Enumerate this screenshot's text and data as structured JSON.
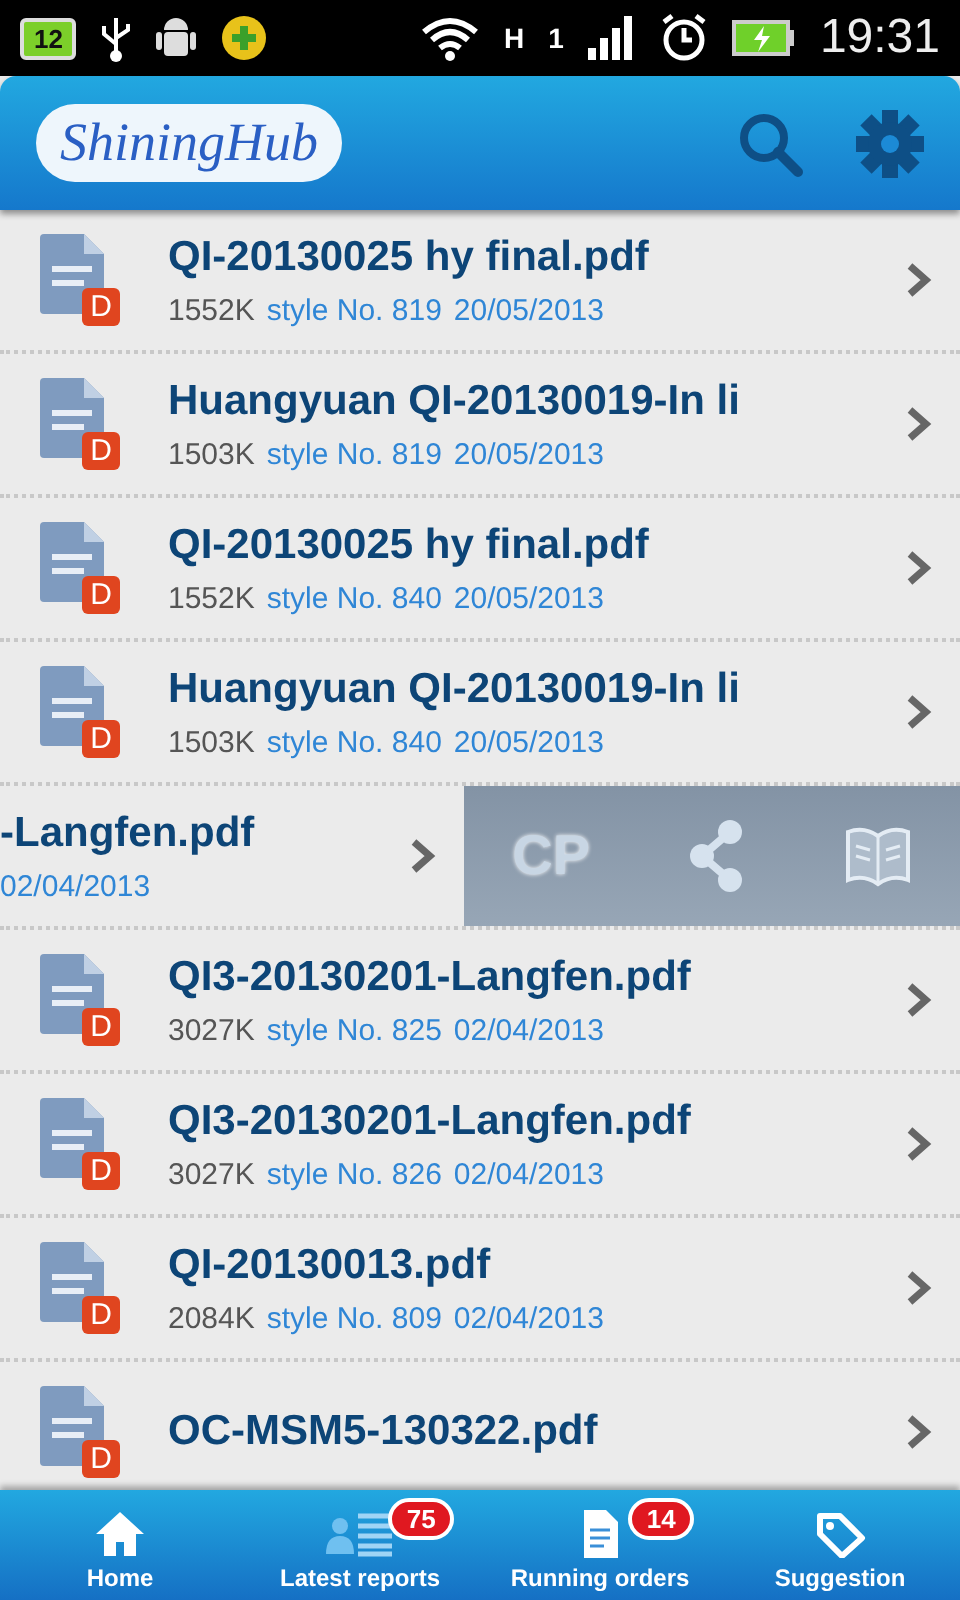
{
  "status_bar": {
    "notification_number": "12",
    "network_type": "H",
    "sim_number": "1",
    "time": "19:31"
  },
  "header": {
    "logo": "ShiningHub"
  },
  "files": [
    {
      "kind": "file",
      "name": "QI-20130025 hy final.pdf",
      "badge": "D",
      "size": "1552K",
      "style": "style No. 819",
      "date": "20/05/2013"
    },
    {
      "kind": "file",
      "name": "Huangyuan QI-20130019-In li",
      "badge": "D",
      "size": "1503K",
      "style": "style No. 819",
      "date": "20/05/2013"
    },
    {
      "kind": "file",
      "name": "QI-20130025 hy final.pdf",
      "badge": "D",
      "size": "1552K",
      "style": "style No. 840",
      "date": "20/05/2013"
    },
    {
      "kind": "file",
      "name": "Huangyuan QI-20130019-In li",
      "badge": "D",
      "size": "1503K",
      "style": "style No. 840",
      "date": "20/05/2013"
    },
    {
      "kind": "swiped",
      "name": "-Langfen.pdf",
      "date": "02/04/2013",
      "actions": [
        {
          "kind": "text",
          "label": "CP"
        },
        {
          "kind": "share"
        },
        {
          "kind": "read"
        }
      ]
    },
    {
      "kind": "file",
      "name": "QI3-20130201-Langfen.pdf",
      "badge": "D",
      "size": "3027K",
      "style": "style No. 825",
      "date": "02/04/2013"
    },
    {
      "kind": "file",
      "name": "QI3-20130201-Langfen.pdf",
      "badge": "D",
      "size": "3027K",
      "style": "style No. 826",
      "date": "02/04/2013"
    },
    {
      "kind": "file",
      "name": "QI-20130013.pdf",
      "badge": "D",
      "size": "2084K",
      "style": "style No. 809",
      "date": "02/04/2013"
    },
    {
      "kind": "file",
      "name": "OC-MSM5-130322.pdf",
      "badge": "D"
    }
  ],
  "bottom_nav": [
    {
      "kind": "home",
      "label": "Home"
    },
    {
      "kind": "reports",
      "label": "Latest reports",
      "badge": "75"
    },
    {
      "kind": "orders",
      "label": "Running orders",
      "badge": "14"
    },
    {
      "kind": "tag",
      "label": "Suggestion"
    }
  ]
}
